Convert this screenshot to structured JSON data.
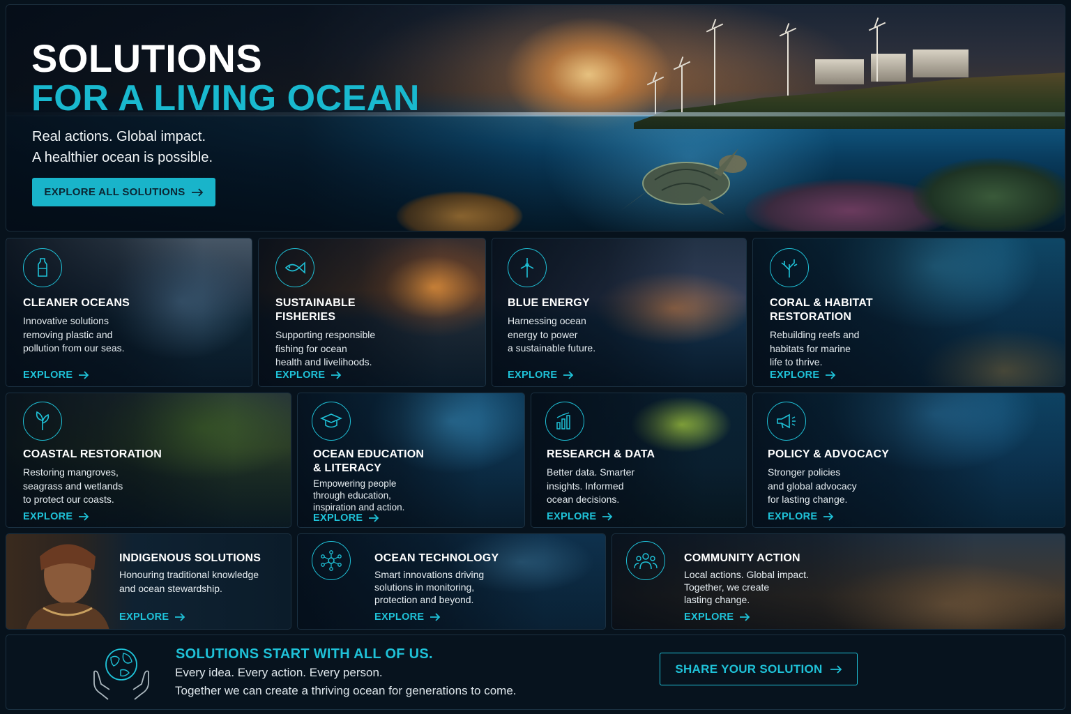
{
  "hero": {
    "title_line1": "SOLUTIONS",
    "title_line2": "FOR A LIVING OCEAN",
    "subtitle_line1": "Real actions. Global impact.",
    "subtitle_line2": "A healthier ocean is possible.",
    "cta_label": "EXPLORE ALL SOLUTIONS"
  },
  "explore_label": "EXPLORE",
  "cards": [
    {
      "id": "cleaner-oceans",
      "icon": "bottle-icon",
      "title_l1": "CLEANER OCEANS",
      "title_l2": "",
      "desc_l1": "Innovative solutions",
      "desc_l2": "removing plastic and",
      "desc_l3": "pollution from our seas."
    },
    {
      "id": "sustainable-fisheries",
      "icon": "fish-icon",
      "title_l1": "SUSTAINABLE",
      "title_l2": "FISHERIES",
      "desc_l1": "Supporting responsible",
      "desc_l2": "fishing for ocean",
      "desc_l3": "health and livelihoods."
    },
    {
      "id": "blue-energy",
      "icon": "wind-turbine-icon",
      "title_l1": "BLUE ENERGY",
      "title_l2": "",
      "desc_l1": "Harnessing ocean",
      "desc_l2": "energy to power",
      "desc_l3": "a sustainable future."
    },
    {
      "id": "coral-habitat",
      "icon": "coral-icon",
      "title_l1": "CORAL & HABITAT",
      "title_l2": "RESTORATION",
      "desc_l1": "Rebuilding reefs and",
      "desc_l2": "habitats for marine",
      "desc_l3": "life to thrive."
    },
    {
      "id": "coastal-restoration",
      "icon": "leaf-icon",
      "title_l1": "COASTAL RESTORATION",
      "title_l2": "",
      "desc_l1": "Restoring mangroves,",
      "desc_l2": "seagrass and wetlands",
      "desc_l3": "to protect our coasts."
    },
    {
      "id": "ocean-education",
      "icon": "graduation-cap-icon",
      "title_l1": "OCEAN EDUCATION",
      "title_l2": "& LITERACY",
      "desc_l1": "Empowering people",
      "desc_l2": "through education,",
      "desc_l3": "inspiration and action."
    },
    {
      "id": "research-data",
      "icon": "bar-chart-icon",
      "title_l1": "RESEARCH & DATA",
      "title_l2": "",
      "desc_l1": "Better data. Smarter",
      "desc_l2": "insights. Informed",
      "desc_l3": "ocean decisions."
    },
    {
      "id": "policy-advocacy",
      "icon": "megaphone-icon",
      "title_l1": "POLICY & ADVOCACY",
      "title_l2": "",
      "desc_l1": "Stronger policies",
      "desc_l2": "and global advocacy",
      "desc_l3": "for lasting change."
    },
    {
      "id": "indigenous-solutions",
      "icon": "",
      "title_l1": "INDIGENOUS SOLUTIONS",
      "title_l2": "",
      "desc_l1": "Honouring traditional knowledge",
      "desc_l2": "and ocean stewardship.",
      "desc_l3": ""
    },
    {
      "id": "ocean-technology",
      "icon": "network-icon",
      "title_l1": "OCEAN TECHNOLOGY",
      "title_l2": "",
      "desc_l1": "Smart innovations driving",
      "desc_l2": "solutions in monitoring,",
      "desc_l3": "protection and beyond."
    },
    {
      "id": "community-action",
      "icon": "community-icon",
      "title_l1": "COMMUNITY ACTION",
      "title_l2": "",
      "desc_l1": "Local actions. Global impact.",
      "desc_l2": "Together, we create",
      "desc_l3": "lasting change."
    }
  ],
  "footer": {
    "icon": "globe-in-hands-icon",
    "title": "SOLUTIONS START WITH ALL OF US.",
    "line1": "Every idea. Every action. Every person.",
    "line2": "Together we can create a thriving ocean for generations to come.",
    "cta_label": "SHARE YOUR SOLUTION"
  },
  "colors": {
    "accent": "#1fc2d8",
    "background": "#07121c",
    "button_fill": "#19b4ca"
  }
}
